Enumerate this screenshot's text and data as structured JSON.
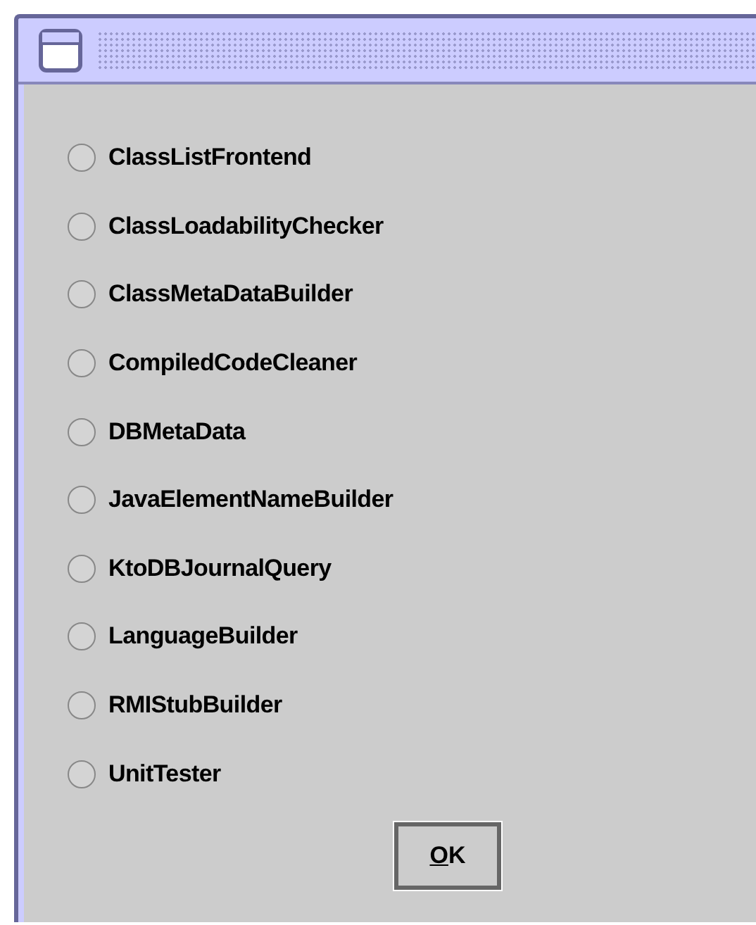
{
  "options": [
    {
      "label": "ClassListFrontend",
      "selected": false
    },
    {
      "label": "ClassLoadabilityChecker",
      "selected": false
    },
    {
      "label": "ClassMetaDataBuilder",
      "selected": false
    },
    {
      "label": "CompiledCodeCleaner",
      "selected": false
    },
    {
      "label": "DBMetaData",
      "selected": false
    },
    {
      "label": "JavaElementNameBuilder",
      "selected": false
    },
    {
      "label": "KtoDBJournalQuery",
      "selected": false
    },
    {
      "label": "LanguageBuilder",
      "selected": false
    },
    {
      "label": "RMIStubBuilder",
      "selected": false
    },
    {
      "label": "UnitTester",
      "selected": false
    }
  ],
  "ok_button": {
    "label": "OK"
  }
}
